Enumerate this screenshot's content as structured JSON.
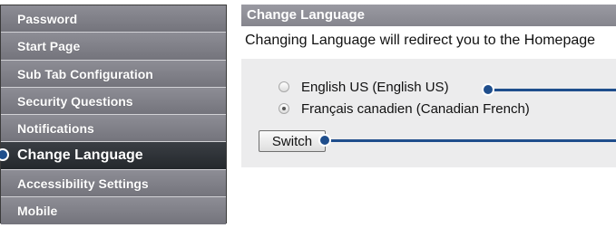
{
  "sidebar": {
    "items": [
      {
        "label": "Password",
        "active": false
      },
      {
        "label": "Start Page",
        "active": false
      },
      {
        "label": "Sub Tab Configuration",
        "active": false
      },
      {
        "label": "Security Questions",
        "active": false
      },
      {
        "label": "Notifications",
        "active": false
      },
      {
        "label": "Change Language",
        "active": true
      },
      {
        "label": "Accessibility Settings",
        "active": false
      },
      {
        "label": "Mobile",
        "active": false
      }
    ]
  },
  "panel": {
    "title": "Change Language",
    "intro": "Changing Language will redirect you to the Homepage",
    "options": [
      {
        "label": "English US (English US)",
        "selected": false
      },
      {
        "label": "Français canadien (Canadian French)",
        "selected": true
      }
    ],
    "switch_label": "Switch"
  },
  "colors": {
    "callout": "#1f4e8c",
    "sidebar_active": "#2b2f34",
    "sidebar_bg": "#7c7c84"
  }
}
